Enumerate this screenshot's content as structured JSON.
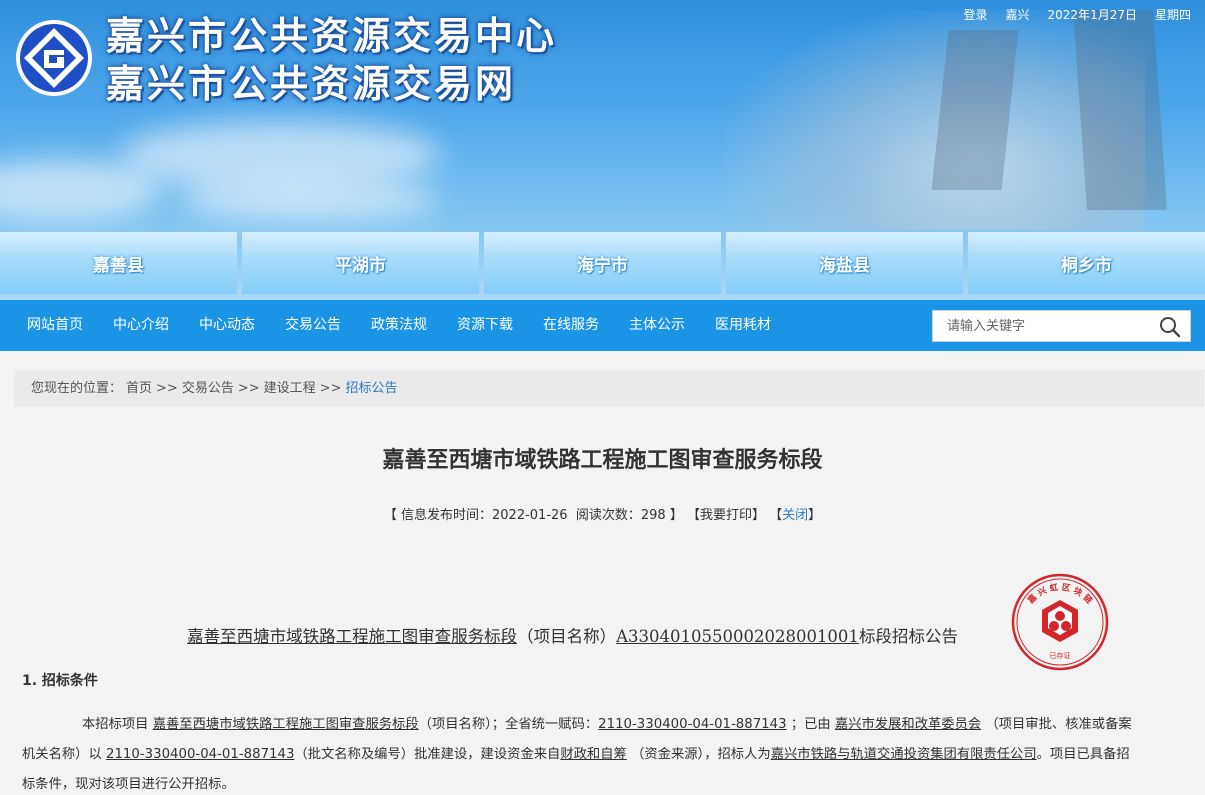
{
  "site": {
    "title_line1": "嘉兴市公共资源交易中心",
    "title_line2": "嘉兴市公共资源交易网"
  },
  "topbar": {
    "login": "登录",
    "city": "嘉兴",
    "date": "2022年1月27日",
    "weekday": "星期四"
  },
  "counties": [
    "嘉善县",
    "平湖市",
    "海宁市",
    "海盐县",
    "桐乡市"
  ],
  "nav": {
    "items": [
      "网站首页",
      "中心介绍",
      "中心动态",
      "交易公告",
      "政策法规",
      "资源下载",
      "在线服务",
      "主体公示",
      "医用耗材"
    ],
    "search_placeholder": "请输入关键字",
    "search_icon": "search-icon"
  },
  "breadcrumb": {
    "label": "您现在的位置：",
    "home": "首页",
    "sep": ">>",
    "level1": "交易公告",
    "level2": "建设工程",
    "current": "招标公告"
  },
  "article": {
    "title": "嘉善至西塘市域铁路工程施工图审查服务标段",
    "meta_open": "【",
    "publish_label": "信息发布时间：",
    "publish_date": "2022-01-26",
    "views_label": "阅读次数：",
    "views": "298",
    "meta_close": "】",
    "print": "【我要打印】",
    "close_open": "【",
    "close": "关闭",
    "close_close": "】",
    "stamp_text": "嘉 兴 虹 区 块 链",
    "stamp_bottom": "已存证",
    "notice_name": "嘉善至西塘市域铁路工程施工图审查服务标段",
    "notice_mid": "（项目名称）",
    "notice_code": "A3304010550002028001001",
    "notice_tail": "标段招标公告",
    "section1": "1.  招标条件",
    "p_intro": "本招标项目",
    "p_project": "嘉善至西塘市域铁路工程施工图审查服务标段",
    "p_a": "（项目名称）；全省统一赋码：",
    "p_code": "2110-330400-04-01-887143",
    "p_b": "；已由",
    "p_agency": "嘉兴市发展和改革委员会",
    "p_c": "（项目审批、核准或备案机关名称）以",
    "p_doc": "2110-330400-04-01-887143",
    "p_d": "（批文名称及编号）批准建设，建设资金来自",
    "p_fund": "财政和自筹",
    "p_e": "（资金来源），招标人为",
    "p_owner": "嘉兴市铁路与轨道交通投资集团有限责任公司",
    "p_f": "。项目已具备招标条件，现对该项目进行公开招标。"
  },
  "colors": {
    "nav": "#1a95e6",
    "link": "#2f78c8",
    "stamp": "#d4252b",
    "logo": "#1e4fc4"
  }
}
